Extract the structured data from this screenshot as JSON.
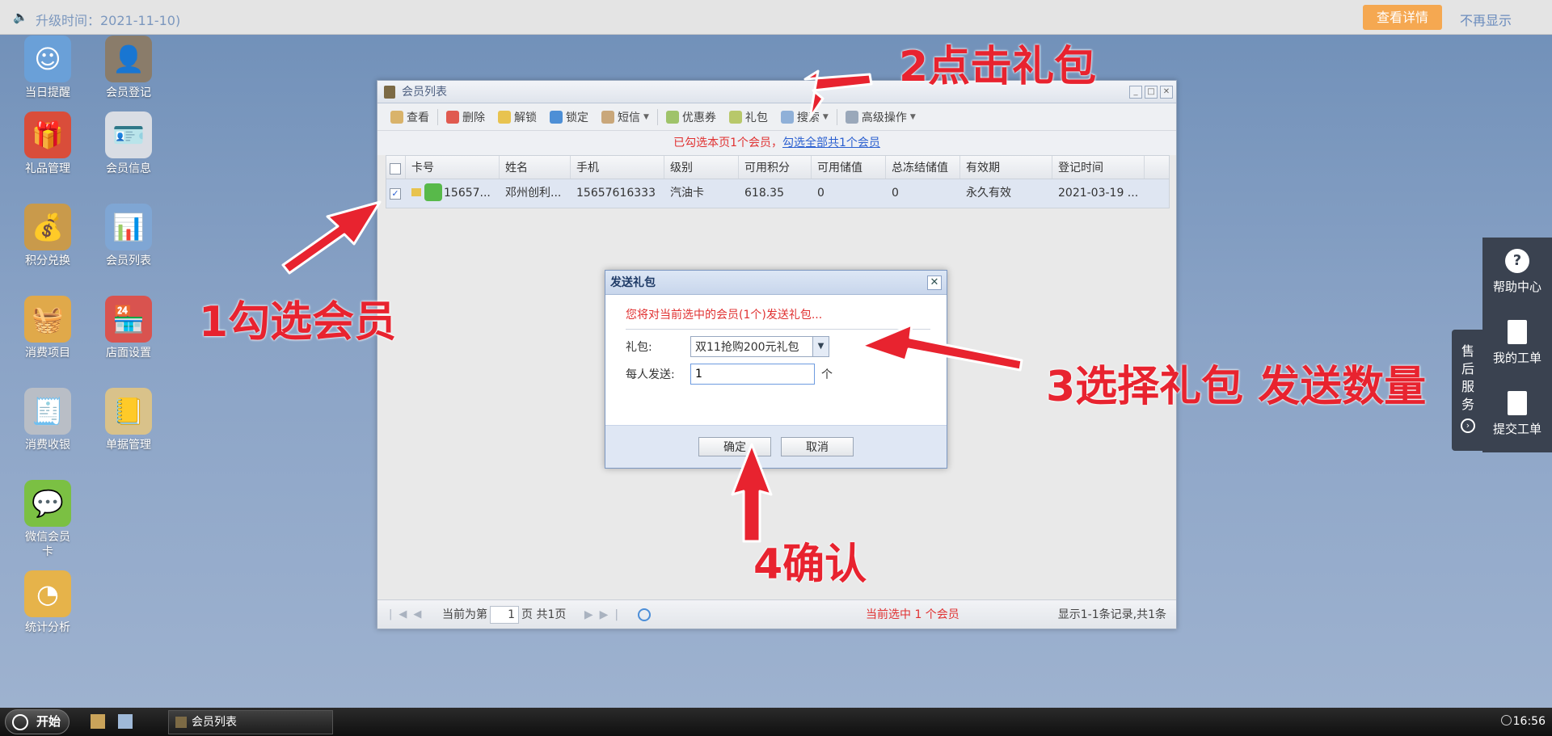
{
  "topbar": {
    "notice": "升级时间：2021-11-10)",
    "detail_button": "查看详情",
    "hide_link": "不再显示"
  },
  "desktop": {
    "icons": [
      {
        "label": "当日提醒",
        "icon": "smiley-icon"
      },
      {
        "label": "会员登记",
        "icon": "user-register-icon"
      },
      {
        "label": "礼品管理",
        "icon": "gift-icon"
      },
      {
        "label": "会员信息",
        "icon": "member-card-icon"
      },
      {
        "label": "积分兑换",
        "icon": "coin-bag-icon"
      },
      {
        "label": "会员列表",
        "icon": "member-list-icon"
      },
      {
        "label": "消费项目",
        "icon": "basket-icon"
      },
      {
        "label": "店面设置",
        "icon": "store-icon"
      },
      {
        "label": "消费收银",
        "icon": "cash-register-icon"
      },
      {
        "label": "单据管理",
        "icon": "notebook-icon"
      },
      {
        "label": "微信会员卡",
        "icon": "wechat-icon"
      },
      {
        "label": "统计分析",
        "icon": "pie-chart-icon"
      }
    ]
  },
  "window": {
    "title": "会员列表",
    "toolbar": {
      "view": "查看",
      "delete": "删除",
      "unlock": "解锁",
      "lock": "锁定",
      "sms": "短信",
      "coupon": "优惠券",
      "gift": "礼包",
      "search": "搜索",
      "advanced": "高级操作"
    },
    "selection": {
      "text": "已勾选本页1个会员，",
      "link": "勾选全部共1个会员"
    },
    "columns": [
      "卡号",
      "姓名",
      "手机",
      "级别",
      "可用积分",
      "可用储值",
      "总冻结储值",
      "有效期",
      "登记时间"
    ],
    "rows": [
      {
        "card": "15657...",
        "name": "邓州创利...",
        "phone": "15657616333",
        "level": "汽油卡",
        "points": "618.35",
        "balance": "0",
        "frozen": "0",
        "valid": "永久有效",
        "registered": "2021-03-19 ..."
      }
    ],
    "pager": {
      "before": "当前为第",
      "page": "1",
      "after": "页 共1页",
      "selected": "当前选中 1 个会员",
      "records": "显示1-1条记录,共1条"
    }
  },
  "dialog": {
    "title": "发送礼包",
    "close": "✕",
    "message": "您将对当前选中的会员(1个)发送礼包...",
    "gift_label": "礼包:",
    "gift_value": "双11抢购200元礼包",
    "qty_label": "每人发送:",
    "qty_value": "1",
    "qty_unit": "个",
    "ok": "确定",
    "cancel": "取消"
  },
  "annotations": {
    "step1": "1勾选会员",
    "step2": "2点击礼包",
    "step3": "3选择礼包 发送数量",
    "step4": "4确认"
  },
  "service": {
    "tab": "售后服务",
    "help": "帮助中心",
    "my_ticket": "我的工单",
    "submit_ticket": "提交工单"
  },
  "taskbar": {
    "start": "开始",
    "task": "会员列表",
    "clock": "16:56"
  },
  "colors": {
    "accent_red": "#e8232f",
    "topbar_button": "#f5a851",
    "link_blue": "#2a5fd0"
  }
}
